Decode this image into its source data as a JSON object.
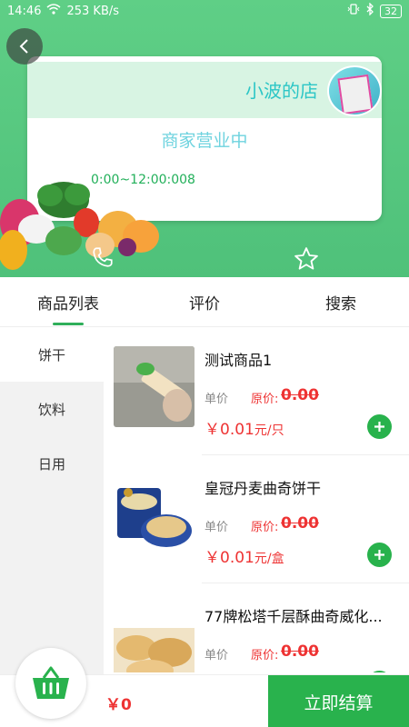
{
  "status_bar": {
    "time": "14:46",
    "speed": "253 KB/s",
    "battery": "32"
  },
  "shop": {
    "name": "小波的店",
    "status": "商家营业中",
    "hours": "0:00~12:00:008"
  },
  "tabs": [
    {
      "label": "商品列表",
      "active": true
    },
    {
      "label": "评价",
      "active": false
    },
    {
      "label": "搜索",
      "active": false
    }
  ],
  "categories": [
    {
      "label": "饼干",
      "active": true
    },
    {
      "label": "饮料",
      "active": false
    },
    {
      "label": "日用",
      "active": false
    }
  ],
  "products": [
    {
      "title": "测试商品1",
      "unit_label": "单价",
      "orig_label": "原价:",
      "orig_price": "0.00",
      "price": "￥0.01",
      "unit": "元/只"
    },
    {
      "title": "皇冠丹麦曲奇饼干",
      "unit_label": "单价",
      "orig_label": "原价:",
      "orig_price": "0.00",
      "price": "￥0.01",
      "unit": "元/盒"
    },
    {
      "title": "77牌松塔千层酥曲奇威化...",
      "unit_label": "单价",
      "orig_label": "原价:",
      "orig_price": "0.00",
      "price": "",
      "unit": ""
    }
  ],
  "cart": {
    "total": "￥0",
    "checkout_label": "立即结算"
  },
  "colors": {
    "accent": "#29b24d",
    "price": "#e33333",
    "header": "#5fcf86"
  }
}
